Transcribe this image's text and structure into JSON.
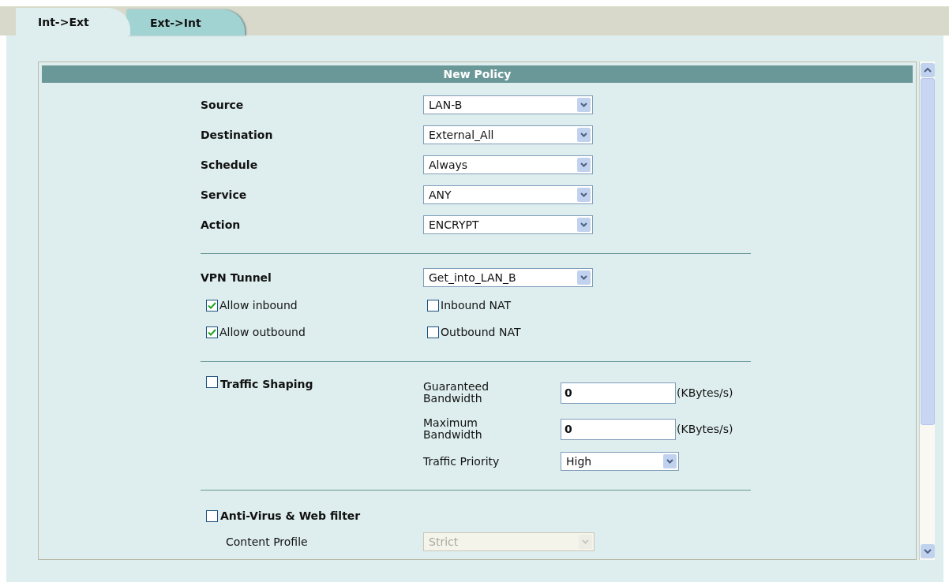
{
  "tabs": [
    {
      "label": "Int->Ext",
      "selected": true
    },
    {
      "label": "Ext->Int",
      "selected": false
    }
  ],
  "panel": {
    "title": "New Policy"
  },
  "fields": [
    {
      "label": "Source",
      "value": "LAN-B"
    },
    {
      "label": "Destination",
      "value": "External_All"
    },
    {
      "label": "Schedule",
      "value": "Always"
    },
    {
      "label": "Service",
      "value": "ANY"
    },
    {
      "label": "Action",
      "value": "ENCRYPT"
    }
  ],
  "vpn": {
    "label": "VPN Tunnel",
    "value": "Get_into_LAN_B",
    "options": [
      {
        "label": "Allow inbound",
        "checked": true
      },
      {
        "label": "Inbound NAT",
        "checked": false
      },
      {
        "label": "Allow outbound",
        "checked": true
      },
      {
        "label": "Outbound NAT",
        "checked": false
      }
    ]
  },
  "traffic_shaping": {
    "label": "Traffic Shaping",
    "checked": false,
    "guaranteed": {
      "label": "Guaranteed Bandwidth",
      "value": "0",
      "unit": "(KBytes/s)"
    },
    "maximum": {
      "label": "Maximum Bandwidth",
      "value": "0",
      "unit": "(KBytes/s)"
    },
    "priority": {
      "label": "Traffic Priority",
      "value": "High"
    }
  },
  "antivirus": {
    "label": "Anti-Virus & Web filter",
    "checked": false,
    "profile": {
      "label": "Content Profile",
      "value": "Strict",
      "disabled": true
    }
  }
}
